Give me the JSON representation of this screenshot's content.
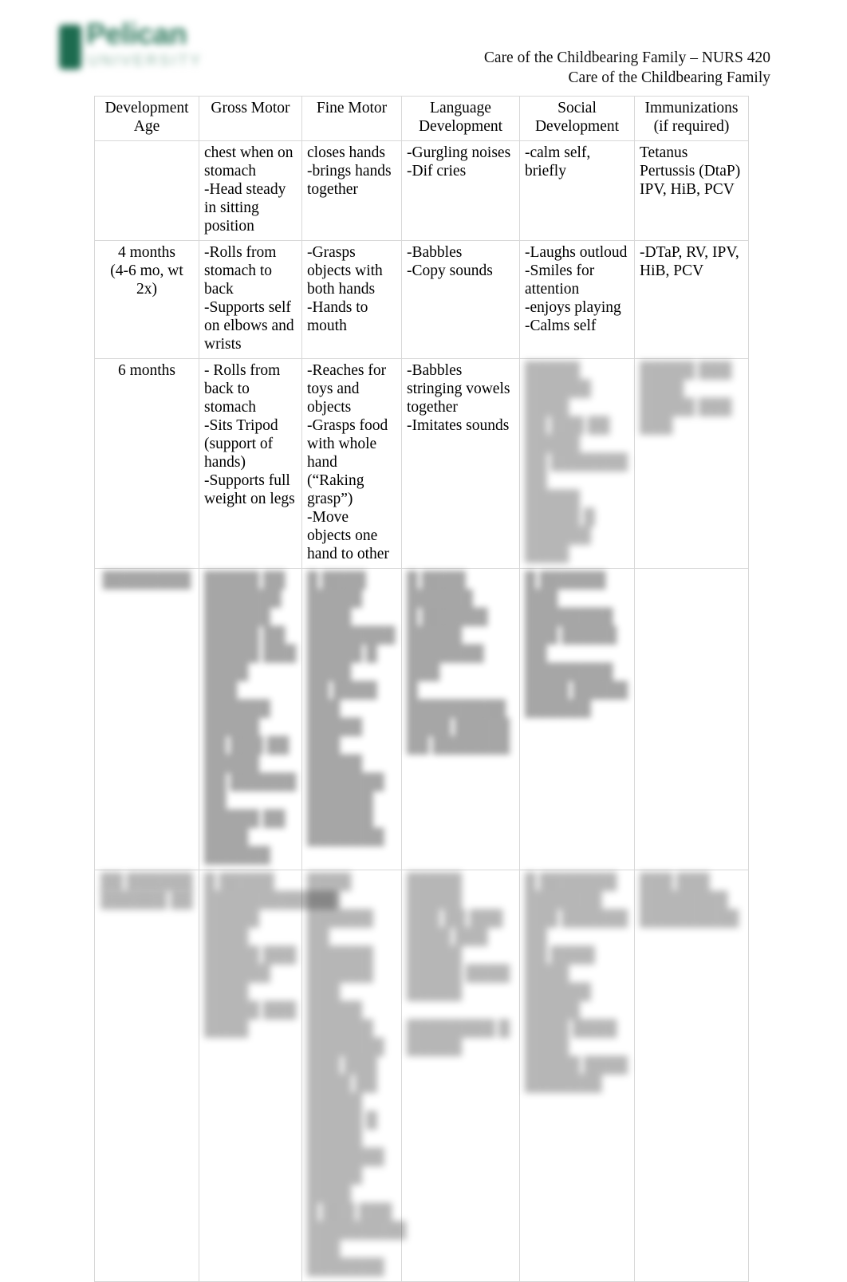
{
  "document": {
    "logo": {
      "wordmark": "Pelican",
      "subtitle": "UNIVERSITY",
      "mark_color": "#1d6b4f",
      "word_color": "#2f7a5e",
      "sub_color": "#8fb6a5"
    },
    "header": {
      "line1": "Care of the Childbearing Family – NURS 420",
      "line2": "Care of the Childbearing Family"
    }
  },
  "table": {
    "columns": [
      {
        "key": "age",
        "line1": "Development",
        "line2": "Age"
      },
      {
        "key": "gross_motor",
        "line1": "Gross Motor",
        "line2": ""
      },
      {
        "key": "fine_motor",
        "line1": "Fine Motor",
        "line2": ""
      },
      {
        "key": "language",
        "line1": "Language",
        "line2": "Development"
      },
      {
        "key": "social",
        "line1": "Social",
        "line2": "Development"
      },
      {
        "key": "immunizations",
        "line1": "Immunizations",
        "line2": "(if required)"
      }
    ],
    "rows": [
      {
        "id": "row-continuation",
        "age": "",
        "age_sub": "",
        "gross_motor": "chest when on stomach\n-Head steady in sitting position",
        "fine_motor": "closes hands\n-brings hands together",
        "language": "-Gurgling noises\n-Dif cries",
        "social": "-calm self, briefly",
        "immunizations": "Tetanus Pertussis (DtaP) IPV, HiB, PCV",
        "obscured": {
          "gross_motor": false,
          "fine_motor": false,
          "language": false,
          "social": false,
          "immunizations": false
        }
      },
      {
        "id": "row-4-months",
        "age": "4 months",
        "age_sub": "(4-6 mo, wt 2x)",
        "gross_motor": "-Rolls from stomach to back\n-Supports self on elbows and wrists",
        "fine_motor": "-Grasps objects with both hands\n-Hands to mouth",
        "language": "-Babbles\n-Copy sounds",
        "social": "-Laughs outloud\n-Smiles for attention\n-enjoys playing\n-Calms self",
        "immunizations": "-DTaP, RV, IPV, HiB, PCV",
        "obscured": {
          "gross_motor": false,
          "fine_motor": false,
          "language": false,
          "social": false,
          "immunizations": false
        }
      },
      {
        "id": "row-6-months",
        "age": "6 months",
        "age_sub": "",
        "gross_motor": "- Rolls from back to stomach\n-Sits Tripod (support of hands)\n-Supports full weight on legs",
        "fine_motor": "-Reaches for toys and objects\n-Grasps food with whole hand (“Raking grasp”)\n-Move objects one hand to other",
        "language": "-Babbles stringing vowels together\n-Imitates sounds",
        "social": "█████ ██████ ████\n██ ███ ██ █████\n██ ███████ ██\n█████\n█████ █ ██████\n████",
        "immunizations": "█████ ███ ████\n█████ ███ ███",
        "obscured": {
          "gross_motor": false,
          "fine_motor": false,
          "language": false,
          "social": true,
          "immunizations": true
        }
      },
      {
        "id": "row-obscured-1",
        "age": "████████",
        "age_sub": "",
        "gross_motor": "█████ ██\n███████\n██████\n█████ ██\n█████ ███\n████\n███ ██████\n█████\n██ ███ ██ █████\n██ ██████ ██\n█████ ██ ████ ██████",
        "fine_motor": "█ ████ █████\n████\n████████\n█████ █ ████\n██ ████ ███\n█████ ███ █████\n███████\n██████\n██████ ███████",
        "language": "█ ████ ██████\n█ ██████ █████\n███████ ███\n█ █████████ ████ █████ ██ ███████",
        "social": "█ ██████ ███\n████████\n███ █████ ██\n████████ ████ █████ ██████",
        "immunizations": "",
        "obscured": {
          "gross_motor": true,
          "fine_motor": true,
          "language": true,
          "social": true,
          "immunizations": true
        }
      },
      {
        "id": "row-obscured-2",
        "age": "██ ██████",
        "age_sub": "██████ ██",
        "gross_motor": "█ █████\n████████████\n█████ ████\n█████ ███\n██████\n████ █████ ███\n████",
        "fine_motor": "████\n███ ██████ ██\n██████ ██████ ███\n█████ ██████\n███████ ███ ███\n████ ██ █████\n█████ █ █████ ███████\n█████ ████\n█ ███ ███ █████████ ███\n███████",
        "language": "█████ █████\n███ ██ ███\n████ ███ █████\n█████ ████ █████\n\n████████ █ █████",
        "social": "█ ███████ ███████\n███ ██████ ██\n██ ████ ████\n██████ █████\n████ ████ ████\n█████ ████ ███████",
        "immunizations": "███ ███\n████████\n█████████",
        "obscured": {
          "gross_motor": true,
          "fine_motor": true,
          "language": true,
          "social": true,
          "immunizations": true
        }
      }
    ]
  }
}
